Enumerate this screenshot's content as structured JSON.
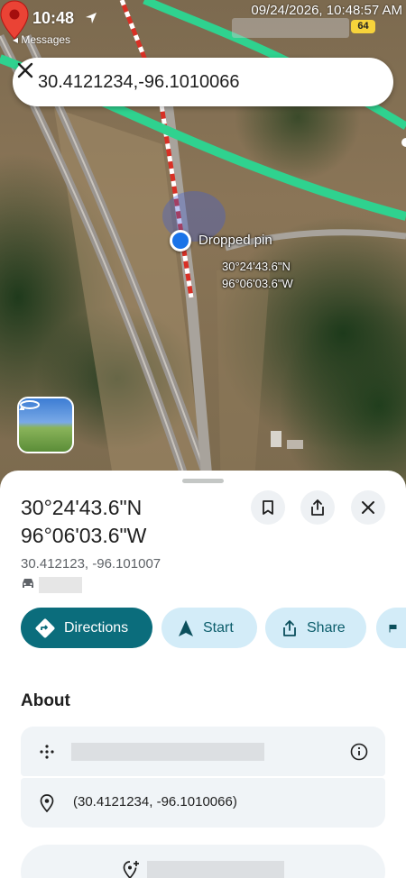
{
  "status_bar": {
    "time": "10:48",
    "back_label": "◂ Messages",
    "battery": "64",
    "timestamp": "09/24/2026, 10:48:57 AM"
  },
  "search": {
    "value": "30.4121234,-96.1010066"
  },
  "map": {
    "dropped_pin_label": "Dropped pin",
    "pin_lat": "30°24'43.6\"N",
    "pin_lng": "96°06'03.6\"W"
  },
  "place": {
    "title_lat": "30°24'43.6\"N",
    "title_lng": "96°06'03.6\"W",
    "decimal": "30.412123, -96.101007"
  },
  "actions": {
    "directions": "Directions",
    "start": "Start",
    "share": "Share"
  },
  "about": {
    "heading": "About",
    "coordinates": "(30.4121234, -96.1010066)"
  },
  "colors": {
    "primary": "#0b6d7c",
    "chip_bg": "#d3ecf8",
    "route_green": "#2fd28f",
    "pin_red": "#ea4335",
    "blue_dot": "#1a73e8"
  }
}
